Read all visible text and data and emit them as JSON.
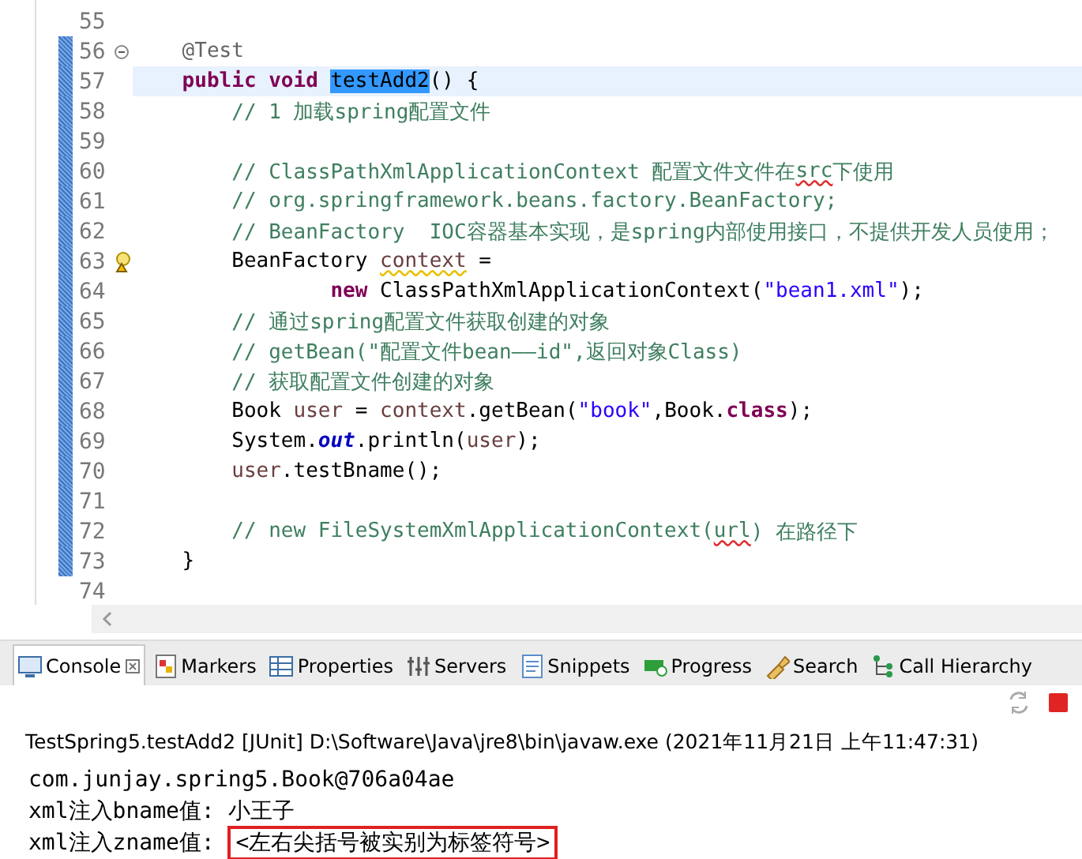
{
  "editor": {
    "lines": [
      {
        "number": "55",
        "changed": false,
        "current": false
      },
      {
        "number": "56",
        "changed": true,
        "current": false,
        "foldable": true,
        "tokens": [
          {
            "kind": "annotation",
            "text": "    @Test"
          }
        ]
      },
      {
        "number": "57",
        "changed": true,
        "current": true,
        "tokens": [
          {
            "kind": "keyword",
            "text": "    public void "
          },
          {
            "kind": "selected",
            "text": "testAdd2"
          },
          {
            "kind": "plain",
            "text": "() {"
          }
        ]
      },
      {
        "number": "58",
        "changed": true,
        "current": false,
        "tokens": [
          {
            "kind": "comment",
            "text": "        // 1 加载spring配置文件"
          }
        ]
      },
      {
        "number": "59",
        "changed": true,
        "current": false
      },
      {
        "number": "60",
        "changed": true,
        "current": false,
        "tokens": [
          {
            "kind": "comment",
            "text": "        // ClassPathXmlApplicationContext 配置文件文件在"
          },
          {
            "kind": "comment-spell",
            "text": "src"
          },
          {
            "kind": "comment",
            "text": "下使用"
          }
        ]
      },
      {
        "number": "61",
        "changed": true,
        "current": false,
        "tokens": [
          {
            "kind": "comment",
            "text": "        // org.springframework.beans.factory.BeanFactory;"
          }
        ]
      },
      {
        "number": "62",
        "changed": true,
        "current": false,
        "tokens": [
          {
            "kind": "comment",
            "text": "        // BeanFactory  IOC容器基本实现，是spring内部使用接口，不提供开发人员使用；"
          }
        ]
      },
      {
        "number": "63",
        "changed": true,
        "current": false,
        "warning": true,
        "tokens": [
          {
            "kind": "plain",
            "text": "        BeanFactory "
          },
          {
            "kind": "variable-warning",
            "text": "context"
          },
          {
            "kind": "plain",
            "text": " ="
          }
        ]
      },
      {
        "number": "64",
        "changed": true,
        "current": false,
        "tokens": [
          {
            "kind": "keyword",
            "text": "                new "
          },
          {
            "kind": "plain",
            "text": "ClassPathXmlApplicationContext("
          },
          {
            "kind": "string",
            "text": "\"bean1.xml\""
          },
          {
            "kind": "plain",
            "text": ");"
          }
        ]
      },
      {
        "number": "65",
        "changed": true,
        "current": false,
        "tokens": [
          {
            "kind": "comment",
            "text": "        // 通过spring配置文件获取创建的对象"
          }
        ]
      },
      {
        "number": "66",
        "changed": true,
        "current": false,
        "tokens": [
          {
            "kind": "comment",
            "text": "        // getBean(\"配置文件bean——id\",返回对象Class)"
          }
        ]
      },
      {
        "number": "67",
        "changed": true,
        "current": false,
        "tokens": [
          {
            "kind": "comment",
            "text": "        // 获取配置文件创建的对象"
          }
        ]
      },
      {
        "number": "68",
        "changed": true,
        "current": false,
        "tokens": [
          {
            "kind": "plain",
            "text": "        Book "
          },
          {
            "kind": "variable",
            "text": "user"
          },
          {
            "kind": "plain",
            "text": " = "
          },
          {
            "kind": "variable",
            "text": "context"
          },
          {
            "kind": "plain",
            "text": ".getBean("
          },
          {
            "kind": "string",
            "text": "\"book\""
          },
          {
            "kind": "plain",
            "text": ",Book."
          },
          {
            "kind": "keyword",
            "text": "class"
          },
          {
            "kind": "plain",
            "text": ");"
          }
        ]
      },
      {
        "number": "69",
        "changed": true,
        "current": false,
        "tokens": [
          {
            "kind": "plain",
            "text": "        System."
          },
          {
            "kind": "field",
            "text": "out"
          },
          {
            "kind": "plain",
            "text": ".println("
          },
          {
            "kind": "variable",
            "text": "user"
          },
          {
            "kind": "plain",
            "text": ");"
          }
        ]
      },
      {
        "number": "70",
        "changed": true,
        "current": false,
        "tokens": [
          {
            "kind": "variable",
            "text": "        user"
          },
          {
            "kind": "plain",
            "text": ".testBname();"
          }
        ]
      },
      {
        "number": "71",
        "changed": true,
        "current": false
      },
      {
        "number": "72",
        "changed": true,
        "current": false,
        "tokens": [
          {
            "kind": "comment",
            "text": "        // new FileSystemXmlApplicationContext("
          },
          {
            "kind": "comment-spell",
            "text": "url"
          },
          {
            "kind": "comment",
            "text": ") 在路径下"
          }
        ]
      },
      {
        "number": "73",
        "changed": true,
        "current": false,
        "tokens": [
          {
            "kind": "plain",
            "text": "    }"
          }
        ]
      },
      {
        "number": "74",
        "changed": false,
        "current": false
      }
    ]
  },
  "tabs": [
    {
      "label": "Console",
      "selected": true,
      "closable": true
    },
    {
      "label": "Markers",
      "selected": false
    },
    {
      "label": "Properties",
      "selected": false
    },
    {
      "label": "Servers",
      "selected": false
    },
    {
      "label": "Snippets",
      "selected": false
    },
    {
      "label": "Progress",
      "selected": false
    },
    {
      "label": "Search",
      "selected": false
    },
    {
      "label": "Call Hierarchy",
      "selected": false
    }
  ],
  "console": {
    "title": "TestSpring5.testAdd2 [JUnit] D:\\Software\\Java\\jre8\\bin\\javaw.exe  (2021年11月21日 上午11:47:31)",
    "terminate_enabled": true,
    "output": [
      {
        "text": "com.junjay.spring5.Book@706a04ae"
      },
      {
        "text": "xml注入bname值: 小王子"
      },
      {
        "text": "xml注入zname值: ",
        "boxed": "<左右尖括号被实别为标签符号>"
      }
    ]
  }
}
